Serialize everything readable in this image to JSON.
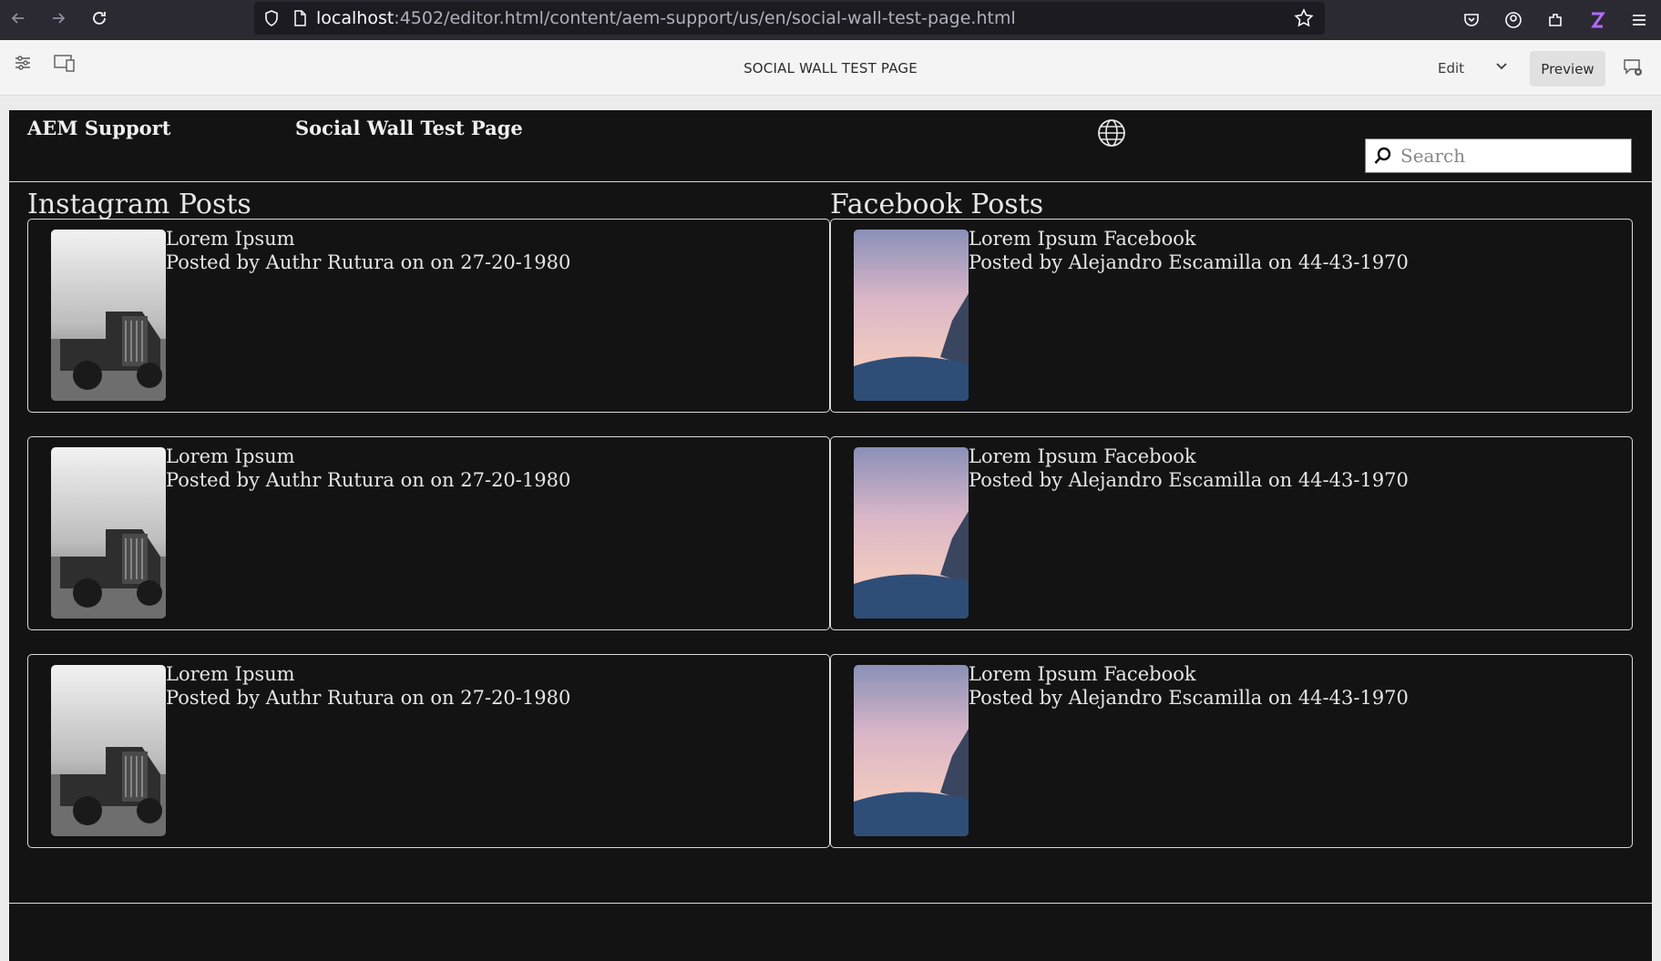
{
  "browser": {
    "url_host": "localhost",
    "url_rest": ":4502/editor.html/content/aem-support/us/en/social-wall-test-page.html"
  },
  "editor": {
    "page_title": "SOCIAL WALL TEST PAGE",
    "mode": "Edit",
    "preview_label": "Preview"
  },
  "site": {
    "brand": "AEM Support",
    "nav_link": "Social Wall Test Page",
    "search_placeholder": "Search"
  },
  "instagram": {
    "heading": "Instagram Posts",
    "posts": [
      {
        "title": "Lorem Ipsum",
        "meta": "Posted by Authr Rutura on on 27-20-1980",
        "image": "vintage-truck-bw"
      },
      {
        "title": "Lorem Ipsum",
        "meta": "Posted by Authr Rutura on on 27-20-1980",
        "image": "vintage-truck-bw"
      },
      {
        "title": "Lorem Ipsum",
        "meta": "Posted by Authr Rutura on on 27-20-1980",
        "image": "vintage-truck-bw"
      }
    ]
  },
  "facebook": {
    "heading": "Facebook Posts",
    "posts": [
      {
        "title": "Lorem Ipsum Facebook",
        "meta": "Posted by Alejandro Escamilla on 44-43-1970",
        "image": "snowy-mountain-dusk"
      },
      {
        "title": "Lorem Ipsum Facebook",
        "meta": "Posted by Alejandro Escamilla on 44-43-1970",
        "image": "snowy-mountain-dusk"
      },
      {
        "title": "Lorem Ipsum Facebook",
        "meta": "Posted by Alejandro Escamilla on 44-43-1970",
        "image": "snowy-mountain-dusk"
      }
    ]
  },
  "colors": {
    "page_bg": "#131313",
    "chrome_bg": "#2b2a33",
    "editor_bg": "#f4f4f4"
  }
}
